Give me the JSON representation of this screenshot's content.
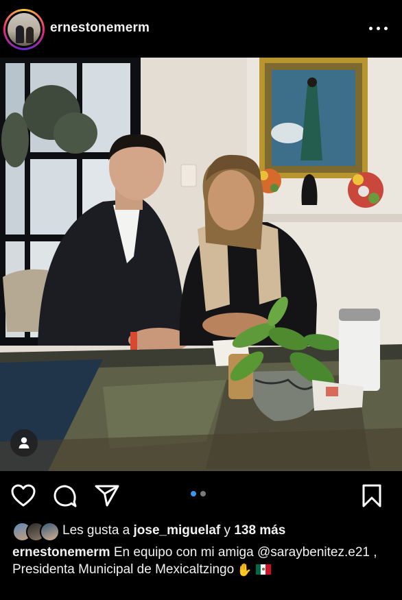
{
  "post": {
    "username": "ernestonemerm",
    "colors": {
      "background": "#000000",
      "text": "#f2f2f2",
      "carousel_active": "#3897f0",
      "carousel_inactive": "#7a7a7a"
    }
  },
  "icons": {
    "header": [
      "avatar",
      "more-options-icon"
    ],
    "photo": [
      "user-tag-icon"
    ],
    "actions": [
      "heart-icon",
      "comment-icon",
      "share-icon",
      "bookmark-icon"
    ]
  },
  "carousel": {
    "count": 2,
    "active": 1
  },
  "likes": {
    "prefix": "Les gusta a ",
    "user": "jose_miguelaf",
    "connector": " y ",
    "others": "138 más"
  },
  "caption": {
    "user": "ernestonemerm",
    "text": "En equipo con mi amiga @saraybenitez.e21 , Presidenta Municipal de Mexicaltzingo"
  }
}
